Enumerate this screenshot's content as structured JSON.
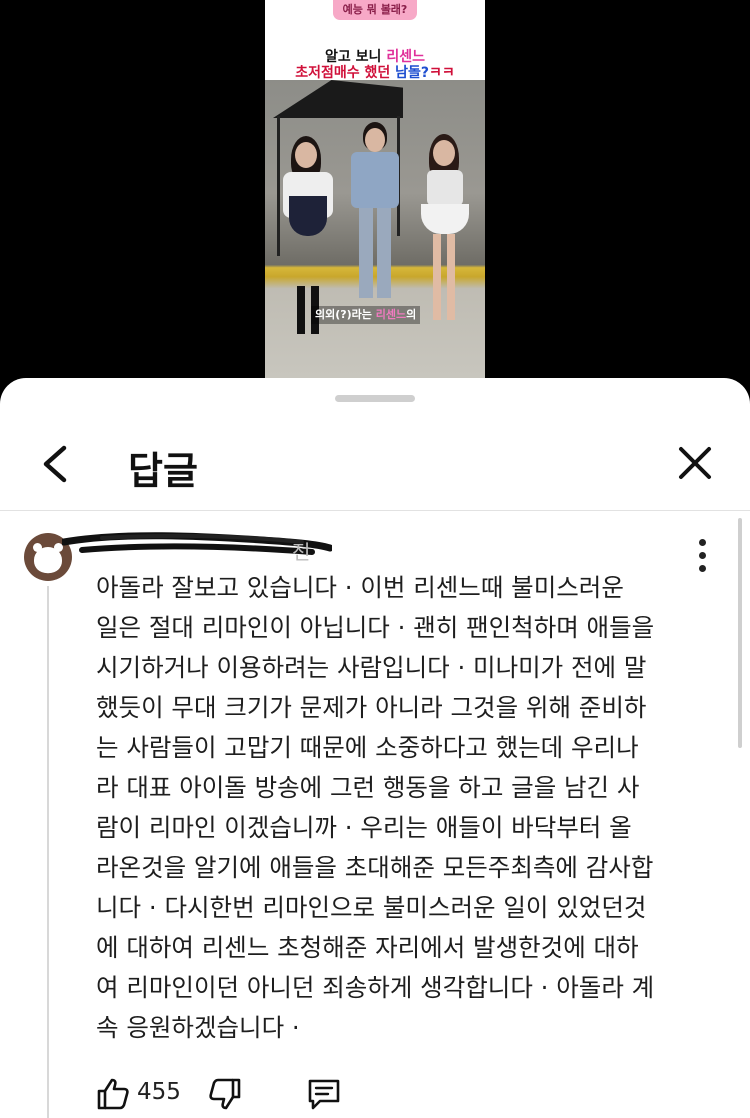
{
  "video": {
    "top_label": "예능 뭐 볼래?",
    "title_line1_a": "알고 보니 ",
    "title_line1_b": "리센느",
    "title_line2_a": "초저점매수 했던 ",
    "title_line2_b": "남돌?",
    "title_line2_c": "ㅋㅋ",
    "subtitle_a": "의외(?)라는 ",
    "subtitle_b": "리센느",
    "subtitle_c": "의"
  },
  "sheet": {
    "title": "답글",
    "back_icon": "chevron-left-icon",
    "close_icon": "close-icon"
  },
  "comment": {
    "author_tail": "전",
    "text": "아돌라 잘보고 있습니다 ·  이번 리센느때 불미스러운\n일은 절대 리마인이 아닙니다 · 괜히 팬인척하며 애들을\n시기하거나 이용하려는 사람입니다 · 미나미가 전에 말\n했듯이 무대 크기가 문제가 아니라 그것을 위해 준비하\n는 사람들이 고맙기 때문에 소중하다고 했는데 우리나\n라 대표 아이돌 방송에 그런 행동을 하고 글을 남긴 사\n람이 리마인 이겠습니까 ·  우리는 애들이 바닥부터 올\n라온것을 알기에 애들을 초대해준 모든주최측에 감사합\n니다 · 다시한번 리마인으로 불미스러운 일이 있었던것\n에 대하여 리센느 초청해준 자리에서 발생한것에 대하\n여 리마인이던 아니던 죄송하게 생각합니다 · 아돌라 계\n속 응원하겠습니다 ·",
    "like_count": "455"
  }
}
